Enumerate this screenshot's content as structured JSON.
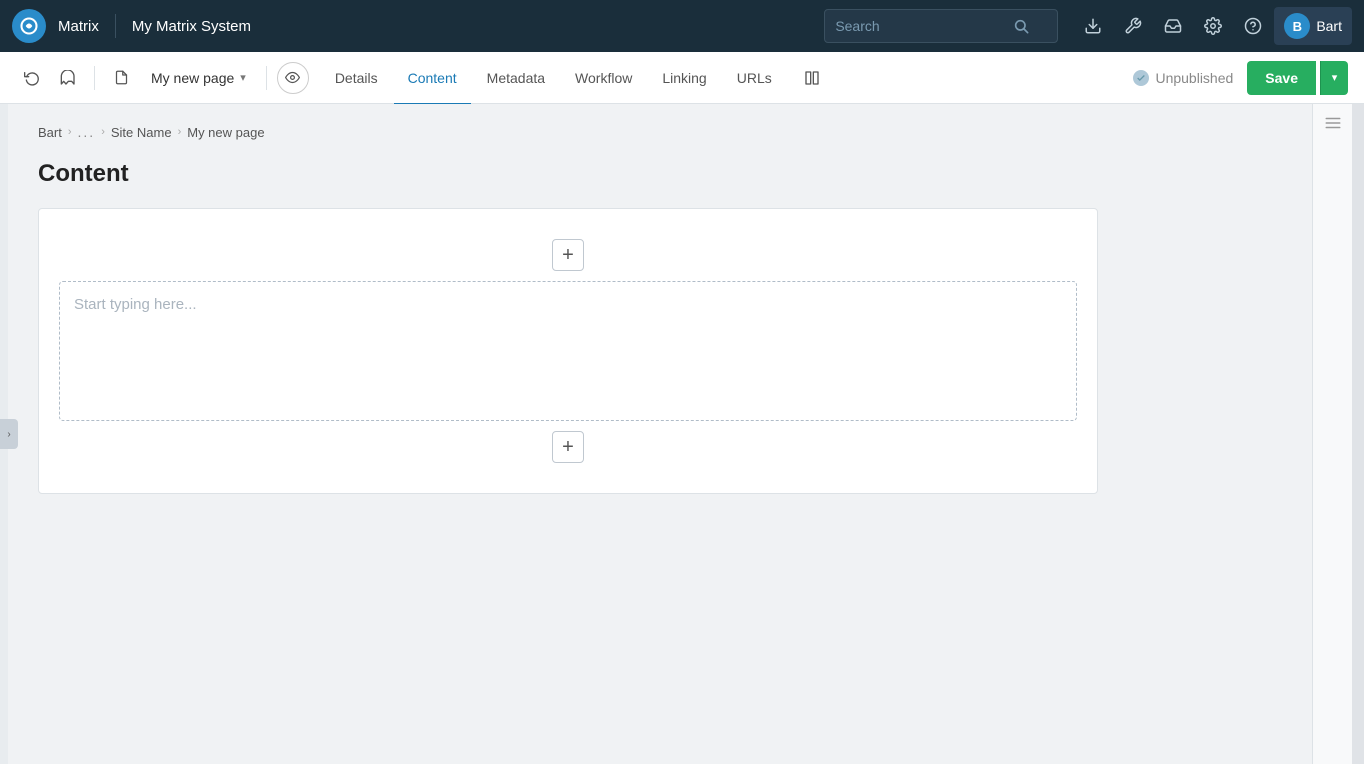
{
  "topbar": {
    "logo_label": "Matrix",
    "system_name": "My Matrix System",
    "search_placeholder": "Search",
    "icons": {
      "download": "⬇",
      "wrench": "🔧",
      "inbox": "✉",
      "settings": "⚙",
      "help": "?"
    },
    "user": {
      "initial": "B",
      "name": "Bart"
    }
  },
  "toolbar2": {
    "history_icon": "↺",
    "ghost_icon": "👁",
    "page_name": "My new page",
    "preview_icon": "👁",
    "tabs": [
      {
        "id": "details",
        "label": "Details",
        "active": false
      },
      {
        "id": "content",
        "label": "Content",
        "active": true
      },
      {
        "id": "metadata",
        "label": "Metadata",
        "active": false
      },
      {
        "id": "workflow",
        "label": "Workflow",
        "active": false
      },
      {
        "id": "linking",
        "label": "Linking",
        "active": false
      },
      {
        "id": "urls",
        "label": "URLs",
        "active": false
      }
    ],
    "compare_icon": "⊟",
    "status": "Unpublished",
    "save_label": "Save",
    "dropdown_icon": "▾"
  },
  "breadcrumb": {
    "items": [
      {
        "label": "Bart"
      },
      {
        "label": "...",
        "type": "dots"
      },
      {
        "label": "Site Name"
      },
      {
        "label": "My new page"
      }
    ]
  },
  "main": {
    "heading": "Content",
    "add_block_label": "+",
    "text_placeholder": "Start typing here...",
    "right_icon": "≡"
  }
}
